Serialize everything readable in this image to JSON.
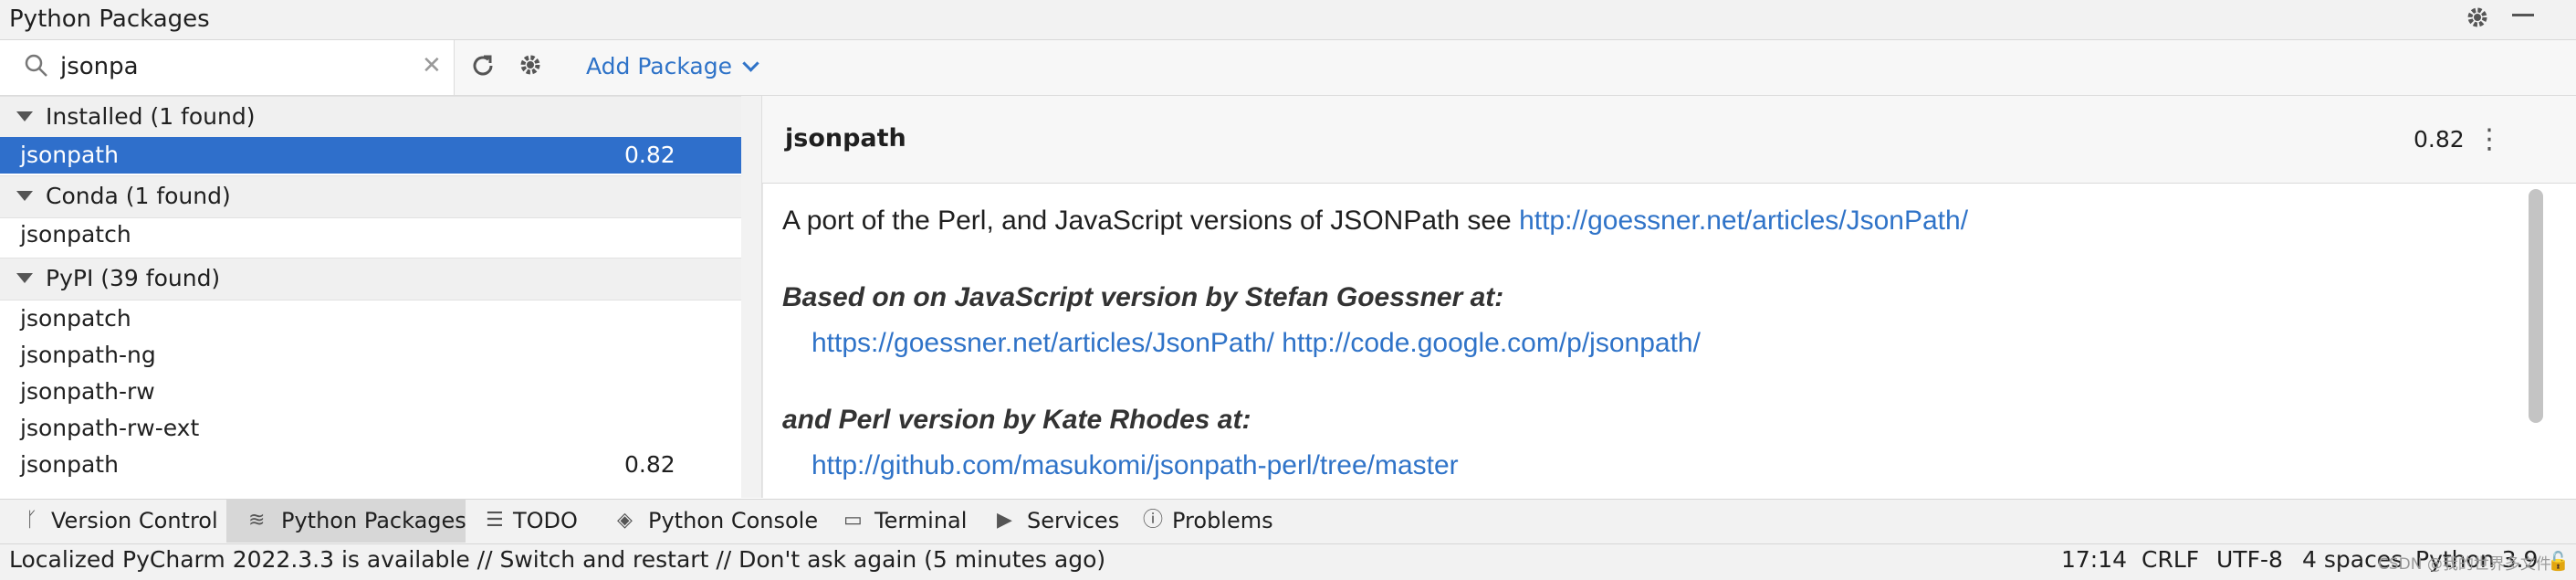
{
  "window": {
    "title": "Python Packages"
  },
  "header_icons": [
    "gear-icon",
    "minimize-icon"
  ],
  "toolbar": {
    "search_value": "jsonpa",
    "clear_icon": "close-icon",
    "refresh_icon": "refresh-icon",
    "settings_icon": "gear-icon",
    "add_package_label": "Add Package"
  },
  "groups": [
    {
      "label": "Installed (1 found)",
      "items": [
        {
          "name": "jsonpath",
          "version": "0.82",
          "selected": true
        }
      ]
    },
    {
      "label": "Conda (1 found)",
      "items": [
        {
          "name": "jsonpatch",
          "version": ""
        }
      ]
    },
    {
      "label": "PyPI (39 found)",
      "items": [
        {
          "name": "jsonpatch",
          "version": ""
        },
        {
          "name": "jsonpath-ng",
          "version": ""
        },
        {
          "name": "jsonpath-rw",
          "version": ""
        },
        {
          "name": "jsonpath-rw-ext",
          "version": ""
        },
        {
          "name": "jsonpath",
          "version": "0.82"
        }
      ]
    }
  ],
  "detail": {
    "name": "jsonpath",
    "version": "0.82",
    "desc_line1": "A port of the Perl, and JavaScript versions of JSONPath see ",
    "desc_link1": "http://goessner.net/articles/JsonPath/",
    "heading_js": "Based on on JavaScript version by Stefan Goessner at:",
    "link_js1": "https://goessner.net/articles/JsonPath/",
    "link_js2": "http://code.google.com/p/jsonpath/",
    "heading_perl": "and Perl version by Kate Rhodes at:",
    "link_perl": "http://github.com/masukomi/jsonpath-perl/tree/master"
  },
  "tool_tabs": [
    {
      "label": "Version Control",
      "icon": "branch-icon"
    },
    {
      "label": "Python Packages",
      "icon": "layers-icon",
      "active": true
    },
    {
      "label": "TODO",
      "icon": "list-icon"
    },
    {
      "label": "Python Console",
      "icon": "python-icon"
    },
    {
      "label": "Terminal",
      "icon": "terminal-icon"
    },
    {
      "label": "Services",
      "icon": "play-icon"
    },
    {
      "label": "Problems",
      "icon": "info-icon"
    }
  ],
  "status": {
    "message": "Localized PyCharm 2022.3.3 is available // Switch and restart // Don't ask again (5 minutes ago)",
    "position": "17:14",
    "line_sep": "CRLF",
    "encoding": "UTF-8",
    "indent": "4 spaces",
    "interpreter": "Python 3.9",
    "watermark": "CSDN @我的世界多文件"
  },
  "colors": {
    "selection": "#2f6fcb",
    "link": "#2f73c8",
    "active_tab": "#d7d7d7"
  }
}
